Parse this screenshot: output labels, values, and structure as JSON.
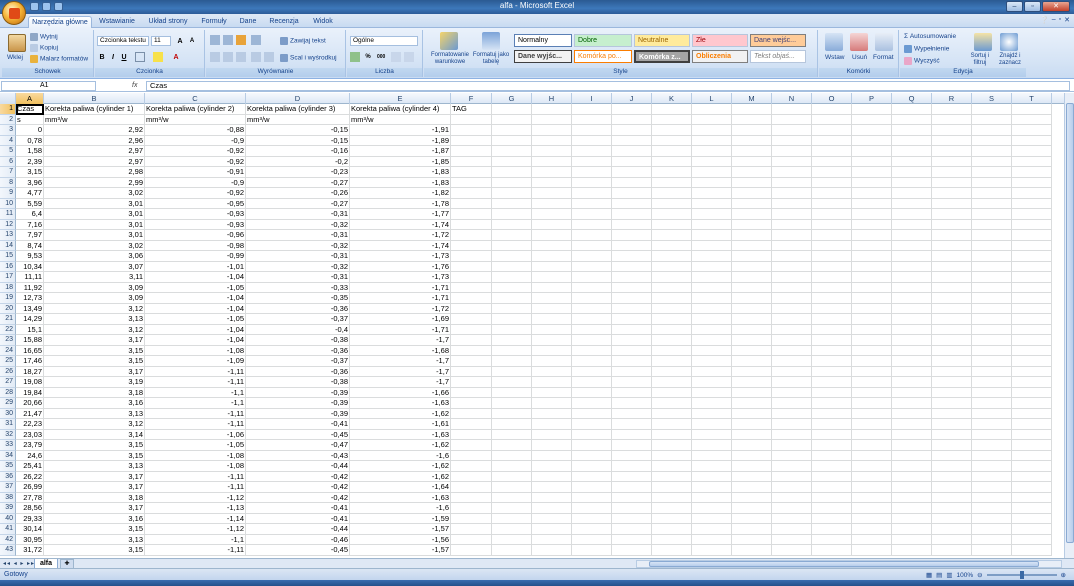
{
  "window": {
    "title": "alfa - Microsoft Excel",
    "controls": [
      "–",
      "▫",
      "✕"
    ]
  },
  "tabs": [
    {
      "label": "Narzędzia główne",
      "active": true
    },
    {
      "label": "Wstawianie"
    },
    {
      "label": "Układ strony"
    },
    {
      "label": "Formuły"
    },
    {
      "label": "Dane"
    },
    {
      "label": "Recenzja"
    },
    {
      "label": "Widok"
    }
  ],
  "ribbon": {
    "clipboard": {
      "paste": "Wklej",
      "cut": "Wytnij",
      "copy": "Kopiuj",
      "painter": "Malarz formatów",
      "label": "Schowek"
    },
    "font": {
      "name": "Czcionka tekstu",
      "size": "11",
      "label": "Czcionka"
    },
    "alignment": {
      "wrap": "Zawijaj tekst",
      "merge": "Scal i wyśrodkuj",
      "label": "Wyrównanie"
    },
    "number": {
      "format": "Ogólne",
      "label": "Liczba"
    },
    "styles": {
      "cond_format": "Formatowanie warunkowe",
      "as_table": "Formatuj jako tabelę",
      "items": [
        "Normalny",
        "Dobre",
        "Neutralne",
        "Złe",
        "Dane wejśc...",
        "Dane wyjśc...",
        "Komórka po...",
        "Komórka z...",
        "Obliczenia",
        "Tekst objaś..."
      ],
      "label": "Style"
    },
    "cells": {
      "insert": "Wstaw",
      "delete": "Usuń",
      "format": "Format",
      "label": "Komórki"
    },
    "editing": {
      "autosum": "Autosumowanie",
      "fill": "Wypełnienie",
      "clear": "Wyczyść",
      "sort": "Sortuj i filtruj",
      "find": "Znajdź i zaznacz",
      "label": "Edycja"
    }
  },
  "formula_bar": {
    "name_box": "A1",
    "fx": "fx",
    "value": "Czas"
  },
  "columns": [
    "A",
    "B",
    "C",
    "D",
    "E",
    "F",
    "G",
    "H",
    "I",
    "J",
    "K",
    "L",
    "M",
    "N",
    "O",
    "P",
    "Q",
    "R",
    "S",
    "T"
  ],
  "header_row": [
    "Czas",
    "Korekta paliwa (cylinder 1)",
    "Korekta paliwa (cylinder 2)",
    "Korekta paliwa (cylinder 3)",
    "Korekta paliwa (cylinder 4)",
    "TAG"
  ],
  "units_row": [
    "s",
    "mm³/w",
    "mm³/w",
    "mm³/w",
    "mm³/w",
    ""
  ],
  "data_rows": [
    [
      "0",
      "2,92",
      "-0,88",
      "-0,15",
      "-1,91"
    ],
    [
      "0,78",
      "2,96",
      "-0,9",
      "-0,15",
      "-1,89"
    ],
    [
      "1,58",
      "2,97",
      "-0,92",
      "-0,16",
      "-1,87"
    ],
    [
      "2,39",
      "2,97",
      "-0,92",
      "-0,2",
      "-1,85"
    ],
    [
      "3,15",
      "2,98",
      "-0,91",
      "-0,23",
      "-1,83"
    ],
    [
      "3,96",
      "2,99",
      "-0,9",
      "-0,27",
      "-1,83"
    ],
    [
      "4,77",
      "3,02",
      "-0,92",
      "-0,26",
      "-1,82"
    ],
    [
      "5,59",
      "3,01",
      "-0,95",
      "-0,27",
      "-1,78"
    ],
    [
      "6,4",
      "3,01",
      "-0,93",
      "-0,31",
      "-1,77"
    ],
    [
      "7,16",
      "3,01",
      "-0,93",
      "-0,32",
      "-1,74"
    ],
    [
      "7,97",
      "3,01",
      "-0,96",
      "-0,31",
      "-1,72"
    ],
    [
      "8,74",
      "3,02",
      "-0,98",
      "-0,32",
      "-1,74"
    ],
    [
      "9,53",
      "3,06",
      "-0,99",
      "-0,31",
      "-1,73"
    ],
    [
      "10,34",
      "3,07",
      "-1,01",
      "-0,32",
      "-1,76"
    ],
    [
      "11,11",
      "3,11",
      "-1,04",
      "-0,31",
      "-1,73"
    ],
    [
      "11,92",
      "3,09",
      "-1,05",
      "-0,33",
      "-1,71"
    ],
    [
      "12,73",
      "3,09",
      "-1,04",
      "-0,35",
      "-1,71"
    ],
    [
      "13,49",
      "3,12",
      "-1,04",
      "-0,36",
      "-1,72"
    ],
    [
      "14,29",
      "3,13",
      "-1,05",
      "-0,37",
      "-1,69"
    ],
    [
      "15,1",
      "3,12",
      "-1,04",
      "-0,4",
      "-1,71"
    ],
    [
      "15,88",
      "3,17",
      "-1,04",
      "-0,38",
      "-1,7"
    ],
    [
      "16,65",
      "3,15",
      "-1,08",
      "-0,36",
      "-1,68"
    ],
    [
      "17,46",
      "3,15",
      "-1,09",
      "-0,37",
      "-1,7"
    ],
    [
      "18,27",
      "3,17",
      "-1,11",
      "-0,36",
      "-1,7"
    ],
    [
      "19,08",
      "3,19",
      "-1,11",
      "-0,38",
      "-1,7"
    ],
    [
      "19,84",
      "3,18",
      "-1,1",
      "-0,39",
      "-1,66"
    ],
    [
      "20,66",
      "3,16",
      "-1,1",
      "-0,39",
      "-1,63"
    ],
    [
      "21,47",
      "3,13",
      "-1,11",
      "-0,39",
      "-1,62"
    ],
    [
      "22,23",
      "3,12",
      "-1,11",
      "-0,41",
      "-1,61"
    ],
    [
      "23,03",
      "3,14",
      "-1,06",
      "-0,45",
      "-1,63"
    ],
    [
      "23,79",
      "3,15",
      "-1,05",
      "-0,47",
      "-1,62"
    ],
    [
      "24,6",
      "3,15",
      "-1,08",
      "-0,43",
      "-1,6"
    ],
    [
      "25,41",
      "3,13",
      "-1,08",
      "-0,44",
      "-1,62"
    ],
    [
      "26,22",
      "3,17",
      "-1,11",
      "-0,42",
      "-1,62"
    ],
    [
      "26,99",
      "3,17",
      "-1,11",
      "-0,42",
      "-1,64"
    ],
    [
      "27,78",
      "3,18",
      "-1,12",
      "-0,42",
      "-1,63"
    ],
    [
      "28,56",
      "3,17",
      "-1,13",
      "-0,41",
      "-1,6"
    ],
    [
      "29,33",
      "3,16",
      "-1,14",
      "-0,41",
      "-1,59"
    ],
    [
      "30,14",
      "3,15",
      "-1,12",
      "-0,44",
      "-1,57"
    ],
    [
      "30,95",
      "3,13",
      "-1,1",
      "-0,46",
      "-1,56"
    ],
    [
      "31,72",
      "3,15",
      "-1,11",
      "-0,45",
      "-1,57"
    ]
  ],
  "sheet_tab": "alfa",
  "status": "Gotowy",
  "zoom": "100%"
}
